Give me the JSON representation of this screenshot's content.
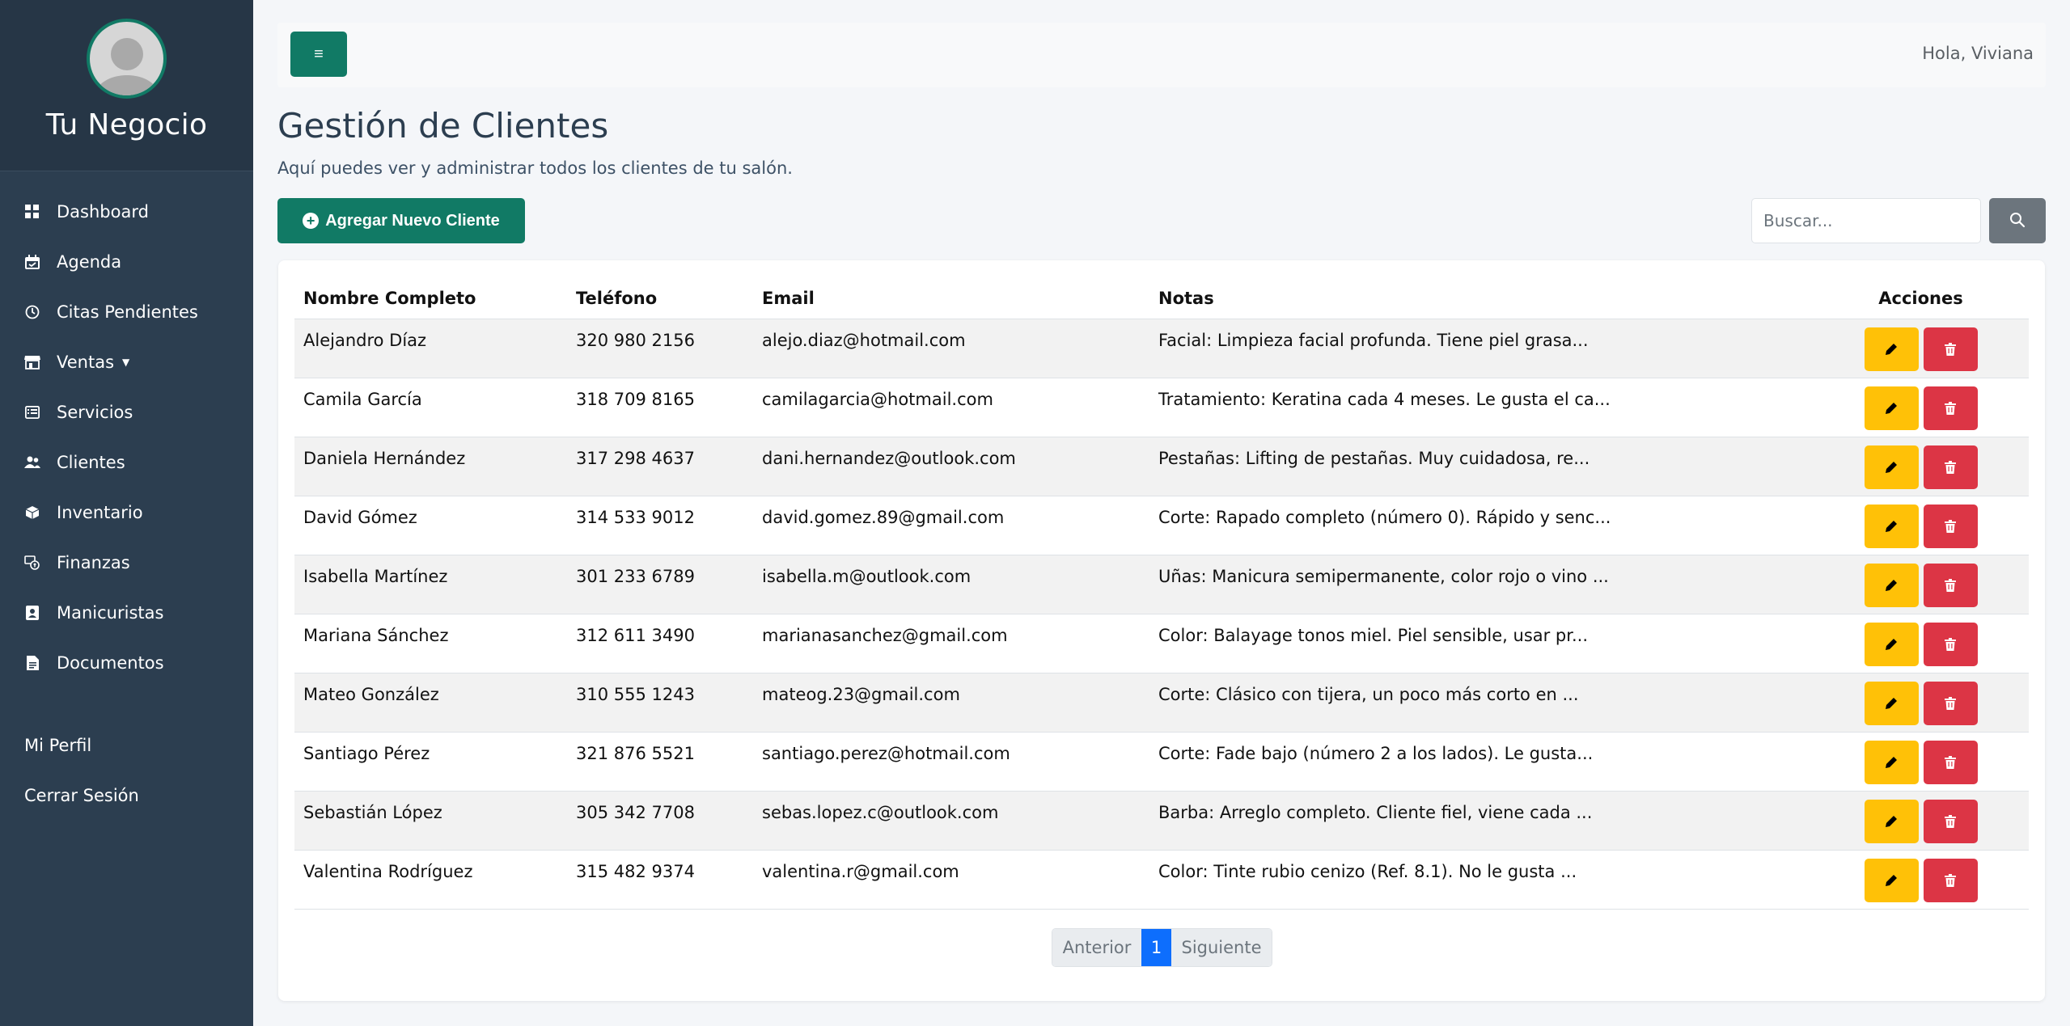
{
  "sidebar": {
    "brand": "Tu Negocio",
    "items": [
      {
        "label": "Dashboard",
        "icon": "dashboard-icon"
      },
      {
        "label": "Agenda",
        "icon": "calendar-icon"
      },
      {
        "label": "Citas Pendientes",
        "icon": "clock-icon"
      },
      {
        "label": "Ventas",
        "icon": "store-icon"
      },
      {
        "label": "Servicios",
        "icon": "list-icon"
      },
      {
        "label": "Clientes",
        "icon": "users-icon"
      },
      {
        "label": "Inventario",
        "icon": "box-icon"
      },
      {
        "label": "Finanzas",
        "icon": "finance-icon"
      },
      {
        "label": "Manicuristas",
        "icon": "person-badge-icon"
      },
      {
        "label": "Documentos",
        "icon": "document-icon"
      }
    ],
    "bottom": [
      {
        "label": "Mi Perfil"
      },
      {
        "label": "Cerrar Sesión"
      }
    ]
  },
  "topbar": {
    "menu_icon": "≡",
    "greeting": "Hola, Viviana"
  },
  "page": {
    "title": "Gestión de Clientes",
    "subtitle": "Aquí puedes ver y administrar todos los clientes de tu salón.",
    "add_button": "Agregar Nuevo Cliente",
    "search_placeholder": "Buscar..."
  },
  "table": {
    "headers": [
      "Nombre Completo",
      "Teléfono",
      "Email",
      "Notas",
      "Acciones"
    ],
    "rows": [
      {
        "name": "Alejandro Díaz",
        "phone": "320 980 2156",
        "email": "alejo.diaz@hotmail.com",
        "notes": "Facial: Limpieza facial profunda. Tiene piel grasa..."
      },
      {
        "name": "Camila García",
        "phone": "318 709 8165",
        "email": "camilagarcia@hotmail.com",
        "notes": "Tratamiento: Keratina cada 4 meses. Le gusta el ca..."
      },
      {
        "name": "Daniela Hernández",
        "phone": "317 298 4637",
        "email": "dani.hernandez@outlook.com",
        "notes": "Pestañas: Lifting de pestañas. Muy cuidadosa, re..."
      },
      {
        "name": "David Gómez",
        "phone": "314 533 9012",
        "email": "david.gomez.89@gmail.com",
        "notes": "Corte: Rapado completo (número 0). Rápido y senc..."
      },
      {
        "name": "Isabella Martínez",
        "phone": "301 233 6789",
        "email": "isabella.m@outlook.com",
        "notes": "Uñas: Manicura semipermanente, color rojo o vino ..."
      },
      {
        "name": "Mariana Sánchez",
        "phone": "312 611 3490",
        "email": "marianasanchez@gmail.com",
        "notes": "Color: Balayage tonos miel. Piel sensible, usar pr..."
      },
      {
        "name": "Mateo González",
        "phone": "310 555 1243",
        "email": "mateog.23@gmail.com",
        "notes": "Corte: Clásico con tijera, un poco más corto en ..."
      },
      {
        "name": "Santiago Pérez",
        "phone": "321 876 5521",
        "email": "santiago.perez@hotmail.com",
        "notes": "Corte: Fade bajo (número 2 a los lados). Le gusta..."
      },
      {
        "name": "Sebastián López",
        "phone": "305 342 7708",
        "email": "sebas.lopez.c@outlook.com",
        "notes": "Barba: Arreglo completo. Cliente fiel, viene cada ..."
      },
      {
        "name": "Valentina Rodríguez",
        "phone": "315 482 9374",
        "email": "valentina.r@gmail.com",
        "notes": "Color: Tinte rubio cenizo (Ref. 8.1). No le gusta ..."
      }
    ]
  },
  "pagination": {
    "prev": "Anterior",
    "current": "1",
    "next": "Siguiente"
  },
  "colors": {
    "sidebar": "#2c3e50",
    "accent": "#117a65",
    "edit": "#ffc107",
    "delete": "#dc3545",
    "page_active": "#0d6efd"
  }
}
